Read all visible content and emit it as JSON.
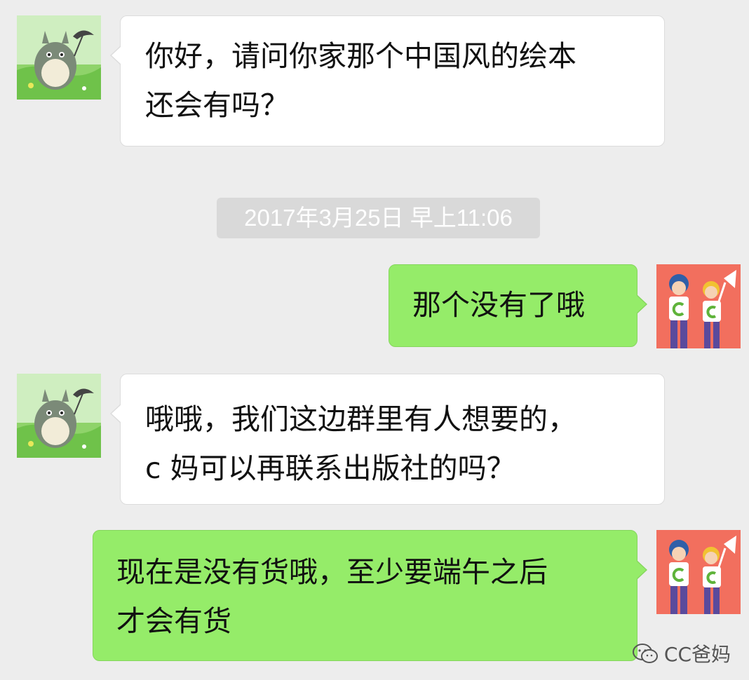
{
  "chat": {
    "messages": [
      {
        "side": "left",
        "text": "你好，请问你家那个中国风的绘本\n还会有吗？"
      },
      {
        "side": "right",
        "text": "那个没有了哦"
      },
      {
        "side": "left",
        "text": "哦哦，我们这边群里有人想要的，\nc 妈可以再联系出版社的吗？"
      },
      {
        "side": "right",
        "text": "现在是没有货哦，至少要端午之后\n才会有货"
      }
    ],
    "timestamp": "2017年3月25日 早上11:06"
  },
  "avatars": {
    "contact": "totoro-avatar",
    "self": "kids-c-avatar"
  },
  "watermark": {
    "icon": "wechat-icon",
    "label": "CC爸妈"
  },
  "colors": {
    "background": "#ededed",
    "incoming_bubble": "#ffffff",
    "outgoing_bubble": "#95ec69",
    "timestamp_bg": "#d9d9d9"
  }
}
